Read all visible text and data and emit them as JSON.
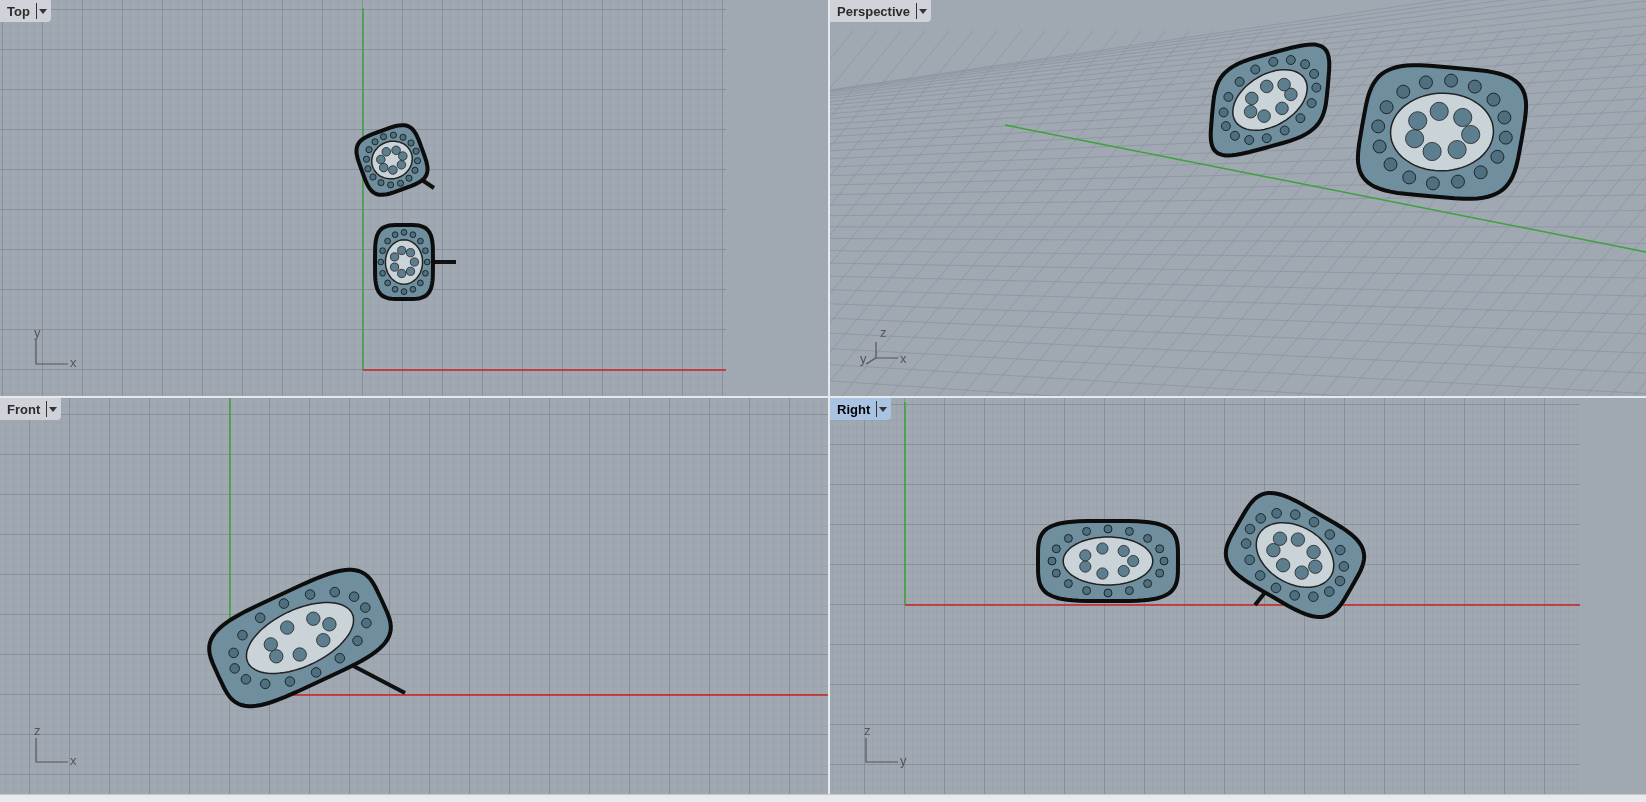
{
  "viewports": [
    {
      "kind": "top",
      "title": "Top",
      "selected": false,
      "axis_labels": [
        "y",
        "x"
      ]
    },
    {
      "kind": "perspective",
      "title": "Perspective",
      "selected": false,
      "axis_labels": [
        "z",
        "y",
        "x"
      ]
    },
    {
      "kind": "front",
      "title": "Front",
      "selected": false,
      "axis_labels": [
        "z",
        "x"
      ]
    },
    {
      "kind": "right",
      "title": "Right",
      "selected": true,
      "axis_labels": [
        "z",
        "y"
      ]
    }
  ]
}
